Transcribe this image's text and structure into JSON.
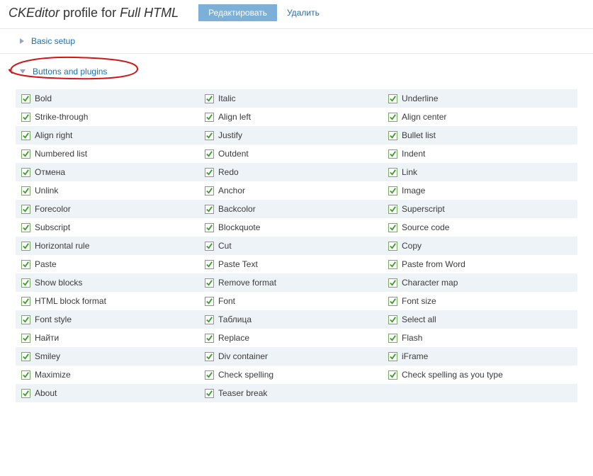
{
  "header": {
    "title_app": "CKEditor",
    "title_mid": " profile for ",
    "title_profile": "Full HTML",
    "tab_edit": "Редактировать",
    "tab_delete": "Удалить"
  },
  "sections": {
    "basic_setup": "Basic setup",
    "buttons_plugins": "Buttons and plugins"
  },
  "rows": [
    [
      "Bold",
      "Italic",
      "Underline"
    ],
    [
      "Strike-through",
      "Align left",
      "Align center"
    ],
    [
      "Align right",
      "Justify",
      "Bullet list"
    ],
    [
      "Numbered list",
      "Outdent",
      "Indent"
    ],
    [
      "Отмена",
      "Redo",
      "Link"
    ],
    [
      "Unlink",
      "Anchor",
      "Image"
    ],
    [
      "Forecolor",
      "Backcolor",
      "Superscript"
    ],
    [
      "Subscript",
      "Blockquote",
      "Source code"
    ],
    [
      "Horizontal rule",
      "Cut",
      "Copy"
    ],
    [
      "Paste",
      "Paste Text",
      "Paste from Word"
    ],
    [
      "Show blocks",
      "Remove format",
      "Character map"
    ],
    [
      "HTML block format",
      "Font",
      "Font size"
    ],
    [
      "Font style",
      "Таблица",
      "Select all"
    ],
    [
      "Найти",
      "Replace",
      "Flash"
    ],
    [
      "Smiley",
      "Div container",
      "iFrame"
    ],
    [
      "Maximize",
      "Check spelling",
      "Check spelling as you type"
    ],
    [
      "About",
      "Teaser break",
      ""
    ]
  ]
}
